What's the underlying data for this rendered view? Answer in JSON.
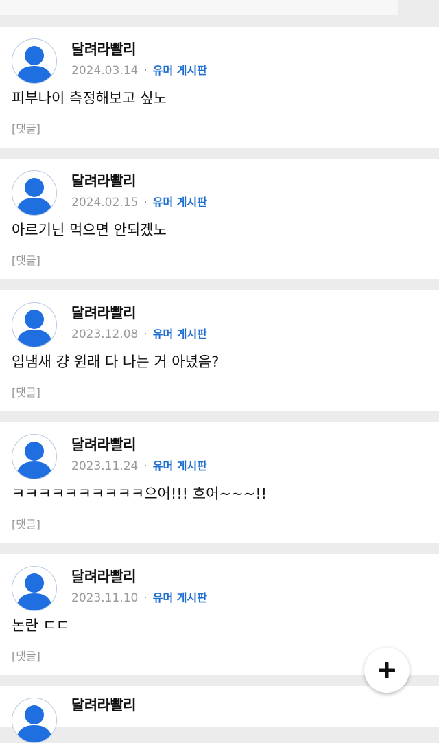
{
  "posts": [
    {
      "author": "달려라빨리",
      "date": "2024.03.14",
      "board": "유머 게시판",
      "content": "피부나이 측정해보고 싶노",
      "reply": "[댓글]"
    },
    {
      "author": "달려라빨리",
      "date": "2024.02.15",
      "board": "유머 게시판",
      "content": "아르기닌 먹으면 안되겠노",
      "reply": "[댓글]"
    },
    {
      "author": "달려라빨리",
      "date": "2023.12.08",
      "board": "유머 게시판",
      "content": "입냄새 걍 원래 다 나는 거 아녔음?",
      "reply": "[댓글]"
    },
    {
      "author": "달려라빨리",
      "date": "2023.11.24",
      "board": "유머 게시판",
      "content": "ㅋㅋㅋㅋㅋㅋㅋㅋㅋㅋ으어!!! 흐어~~~!!",
      "reply": "[댓글]"
    },
    {
      "author": "달려라빨리",
      "date": "2023.11.10",
      "board": "유머 게시판",
      "content": "논란 ㄷㄷ",
      "reply": "[댓글]"
    }
  ],
  "partial_post": {
    "author": "달려라빨리"
  },
  "meta_separator": "·",
  "icons": {
    "avatar": "user-silhouette-icon",
    "fab": "plus-icon"
  },
  "colors": {
    "board_link": "#1e6fd0",
    "avatar": "#1f6fe0",
    "background": "#ececec"
  }
}
